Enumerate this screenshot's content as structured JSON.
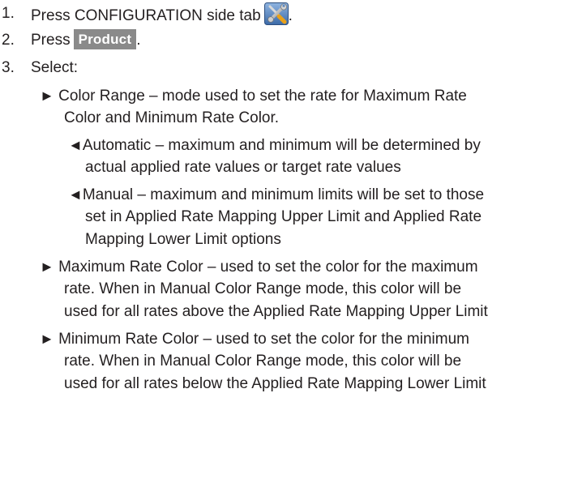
{
  "steps": [
    {
      "number": "1.",
      "text": "Press CONFIGURATION side tab",
      "suffix": ".",
      "icon": "tools-icon"
    },
    {
      "number": "2.",
      "text": "Press",
      "button_label": "Product",
      "suffix": "."
    },
    {
      "number": "3.",
      "text": "Select:"
    }
  ],
  "options": [
    {
      "bullet": "►",
      "lines": [
        "Color Range – mode used to set the rate for Maximum Rate",
        "Color and Minimum Rate Color."
      ],
      "suboptions": [
        {
          "bullet": "◄",
          "lines": [
            "Automatic – maximum and minimum will be determined by",
            "actual applied rate values or target rate values"
          ]
        },
        {
          "bullet": "◄",
          "lines": [
            "Manual – maximum and minimum limits will be set to those",
            "set in Applied Rate Mapping Upper Limit and Applied Rate",
            "Mapping Lower Limit options"
          ]
        }
      ]
    },
    {
      "bullet": "►",
      "lines": [
        "Maximum Rate Color – used to set the color for the maximum",
        "rate. When in Manual Color Range mode, this color will be",
        "used for all rates above the Applied Rate Mapping Upper Limit"
      ]
    },
    {
      "bullet": "►",
      "lines": [
        "Minimum Rate Color – used to set the color for the minimum",
        "rate. When in Manual Color Range mode, this color will be",
        "used for all rates below the Applied Rate Mapping Lower Limit"
      ]
    }
  ],
  "colors": {
    "text": "#231f20",
    "button_bg": "#8a8a8a",
    "button_text": "#ffffff"
  }
}
